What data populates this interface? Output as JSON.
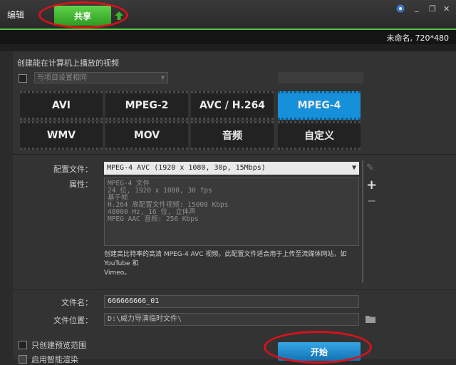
{
  "tabs": {
    "edit": "编辑",
    "share": "共享"
  },
  "status": {
    "project_info": "未命名, 720*480"
  },
  "heading": "创建能在计算机上播放的视频",
  "match_project": {
    "label": "与项目设置相同"
  },
  "top_right_button": "",
  "formats": [
    {
      "label": "AVI",
      "selected": false
    },
    {
      "label": "MPEG-2",
      "selected": false
    },
    {
      "label": "AVC / H.264",
      "selected": false
    },
    {
      "label": "MPEG-4",
      "selected": true
    },
    {
      "label": "WMV",
      "selected": false
    },
    {
      "label": "MOV",
      "selected": false
    },
    {
      "label": "音频",
      "selected": false
    },
    {
      "label": "自定义",
      "selected": false
    }
  ],
  "profile": {
    "label": "配置文件：",
    "value": "MPEG-4 AVC (1920 x 1080, 30p, 15Mbps)"
  },
  "properties": {
    "label": "属性：",
    "lines": [
      "MPEG-4 文件",
      "24 位, 1920 x 1080, 30 fps",
      "基于帧",
      "H.264 高配置文件视频: 15000 Kbps",
      "48000 Hz, 16 位, 立体声",
      "MPEG AAC 音频: 256 Kbps"
    ]
  },
  "description": {
    "line1": "创建高比特率的高清 MPEG-4 AVC 视频。此配置文件适合用于上传至流媒体网站，如 YouTube 和",
    "line2": "Vimeo。"
  },
  "filename": {
    "label": "文件名：",
    "value": "666666666_01"
  },
  "filelocation": {
    "label": "文件位置：",
    "value": "D:\\威力导演临时文件\\"
  },
  "options": {
    "preview_only": "只创建预览范围",
    "smart_render": "启用智能渲染"
  },
  "start_button": "开始",
  "colors": {
    "accent_green": "#3fb52c",
    "selected_blue": "#1790da",
    "annotation_red": "#d8121c"
  }
}
